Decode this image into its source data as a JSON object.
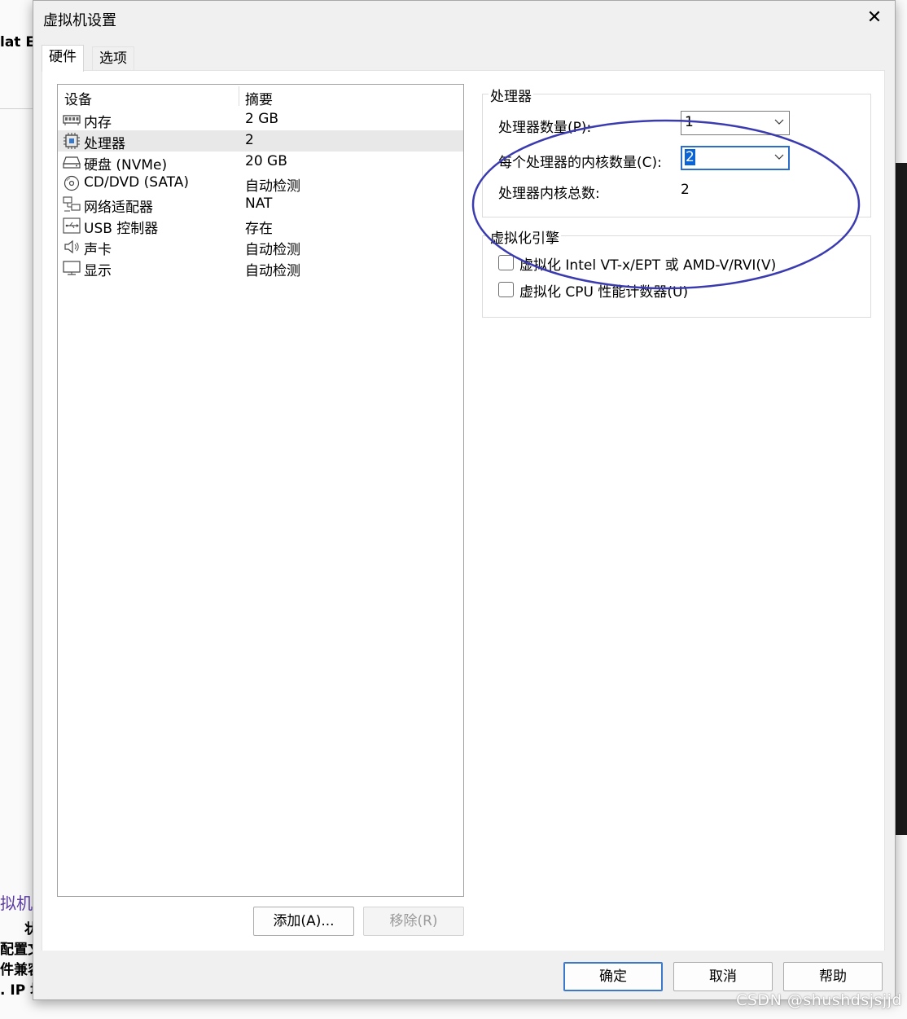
{
  "background": {
    "left_texts": [
      "lat Eu",
      "拟机",
      "状",
      "配置文",
      "件兼容",
      ". IP 地"
    ]
  },
  "dialog": {
    "title": "虚拟机设置",
    "close_glyph": "✕"
  },
  "tabs": [
    {
      "label": "硬件",
      "active": true
    },
    {
      "label": "选项",
      "active": false
    }
  ],
  "device_list": {
    "headers": {
      "device": "设备",
      "summary": "摘要"
    },
    "rows": [
      {
        "name": "内存",
        "summary": "2 GB",
        "icon": "memory-icon",
        "selected": false
      },
      {
        "name": "处理器",
        "summary": "2",
        "icon": "processor-icon",
        "selected": true
      },
      {
        "name": "硬盘 (NVMe)",
        "summary": "20 GB",
        "icon": "hard-disk-icon",
        "selected": false
      },
      {
        "name": "CD/DVD (SATA)",
        "summary": "自动检测",
        "icon": "cd-dvd-icon",
        "selected": false
      },
      {
        "name": "网络适配器",
        "summary": "NAT",
        "icon": "network-adapter-icon",
        "selected": false
      },
      {
        "name": "USB 控制器",
        "summary": "存在",
        "icon": "usb-icon",
        "selected": false
      },
      {
        "name": "声卡",
        "summary": "自动检测",
        "icon": "sound-card-icon",
        "selected": false
      },
      {
        "name": "显示",
        "summary": "自动检测",
        "icon": "display-icon",
        "selected": false
      }
    ]
  },
  "list_buttons": {
    "add": "添加(A)...",
    "remove": "移除(R)"
  },
  "processor": {
    "group_label": "处理器",
    "count_label": "处理器数量(P):",
    "count_value": "1",
    "cores_label": "每个处理器的内核数量(C):",
    "cores_value": "2",
    "total_label": "处理器内核总数:",
    "total_value": "2"
  },
  "virtualization": {
    "group_label": "虚拟化引擎",
    "option1": "虚拟化 Intel VT-x/EPT 或 AMD-V/RVI(V)",
    "option1_checked": false,
    "option2": "虚拟化 CPU 性能计数器(U)",
    "option2_checked": false
  },
  "footer_buttons": {
    "ok": "确定",
    "cancel": "取消",
    "help": "帮助"
  },
  "annotation_color": "#3b3bb0",
  "selection_color": "#0a64d6",
  "watermark": "CSDN @shushdsjsjjd"
}
